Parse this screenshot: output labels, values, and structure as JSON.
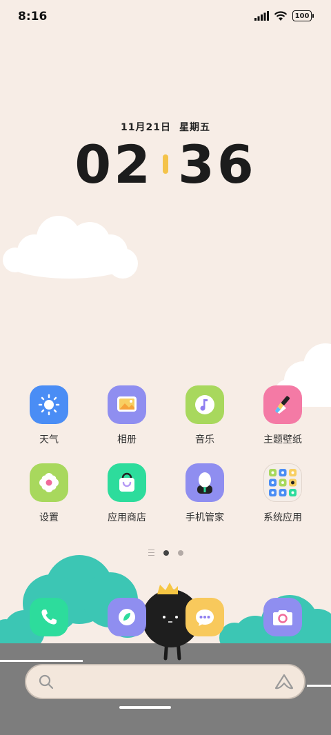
{
  "status": {
    "time": "8:16",
    "battery": "100"
  },
  "clock": {
    "date": "11月21日",
    "weekday": "星期五",
    "hours": "02",
    "minutes": "36"
  },
  "apps": [
    {
      "label": "天气",
      "icon": "weather-icon",
      "color": "#4a8df5"
    },
    {
      "label": "相册",
      "icon": "gallery-icon",
      "color": "#8f8ef0"
    },
    {
      "label": "音乐",
      "icon": "music-icon",
      "color": "#a8d85d"
    },
    {
      "label": "主题壁纸",
      "icon": "themes-icon",
      "color": "#f47aa5"
    },
    {
      "label": "设置",
      "icon": "settings-icon",
      "color": "#a8d85d"
    },
    {
      "label": "应用商店",
      "icon": "app-store-icon",
      "color": "#2ddc9c"
    },
    {
      "label": "手机管家",
      "icon": "phone-manager-icon",
      "color": "#8f8ef0"
    },
    {
      "label": "系统应用",
      "icon": "folder-icon",
      "color": "#f5eee9"
    }
  ],
  "dock": [
    {
      "icon": "phone-icon",
      "color": "#2ddc9c"
    },
    {
      "icon": "browser-icon",
      "color": "#8f8ef0"
    },
    {
      "icon": "messages-icon",
      "color": "#f8c95c"
    },
    {
      "icon": "camera-icon",
      "color": "#8f8ef0"
    }
  ],
  "colors": {
    "background": "#f7ede6",
    "bush": "#3cc6b4",
    "road": "#7d7d7d",
    "colon": "#f4c34a"
  }
}
